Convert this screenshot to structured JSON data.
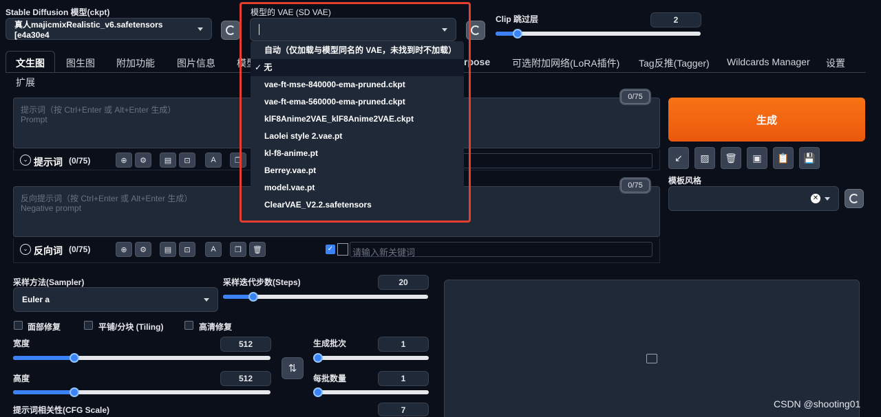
{
  "model_select": {
    "label": "Stable Diffusion 模型(ckpt)",
    "value": "真人majicmixRealistic_v6.safetensors [e4a30e4"
  },
  "vae_select": {
    "label": "模型的 VAE (SD VAE)",
    "value": "",
    "options": [
      "自动（仅加载与模型同名的 VAE，未找到时不加载）",
      "无",
      "vae-ft-mse-840000-ema-pruned.ckpt",
      "vae-ft-ema-560000-ema-pruned.ckpt",
      "klF8Anime2VAE_klF8Anime2VAE.ckpt",
      "Laolei style 2.vae.pt",
      "kl-f8-anime.pt",
      "Berrey.vae.pt",
      "model.vae.pt",
      "ClearVAE_V2.2.safetensors"
    ],
    "checked_index": 1,
    "check_mark": "✓"
  },
  "clip_skip": {
    "label": "Clip 跳过层",
    "value": "2",
    "fraction": 0.1
  },
  "tabs": [
    "文生图",
    "图生图",
    "附加功能",
    "图片信息",
    "模型",
    "rpose",
    "可选附加网络(LoRA插件)",
    "Tag反推(Tagger)",
    "Wildcards Manager",
    "设置",
    "扩展"
  ],
  "prompt": {
    "placeholder_line1": "提示词（按 Ctrl+Enter 或 Alt+Enter 生成）",
    "placeholder_line2": "Prompt",
    "counter": "0/75",
    "title": "提示词",
    "count": "(0/75)"
  },
  "negative_prompt": {
    "placeholder_line1": "反向提示词（按 Ctrl+Enter 或 Alt+Enter 生成）",
    "placeholder_line2": "Negative prompt",
    "counter": "0/75",
    "title": "反向词",
    "count": "(0/75)",
    "keyword_placeholder": "请输入新关键词"
  },
  "generate_button": "生成",
  "style_label": "模板风格",
  "sampler": {
    "label": "采样方法(Sampler)",
    "value": "Euler a"
  },
  "steps": {
    "label": "采样迭代步数(Steps)",
    "value": "20",
    "fraction": 0.15
  },
  "checkboxes": [
    "面部修复",
    "平铺/分块 (Tiling)",
    "高清修复"
  ],
  "width": {
    "label": "宽度",
    "value": "512",
    "fraction": 0.23
  },
  "height": {
    "label": "高度",
    "value": "512",
    "fraction": 0.23
  },
  "batch_count": {
    "label": "生成批次",
    "value": "1",
    "fraction": 0
  },
  "batch_size": {
    "label": "每批数量",
    "value": "1",
    "fraction": 0
  },
  "cfg": {
    "label": "提示词相关性(CFG Scale)",
    "value": "7"
  },
  "watermark": "CSDN @shooting01",
  "highlight_color": "#e53e2f",
  "accent_color": "#f97316"
}
